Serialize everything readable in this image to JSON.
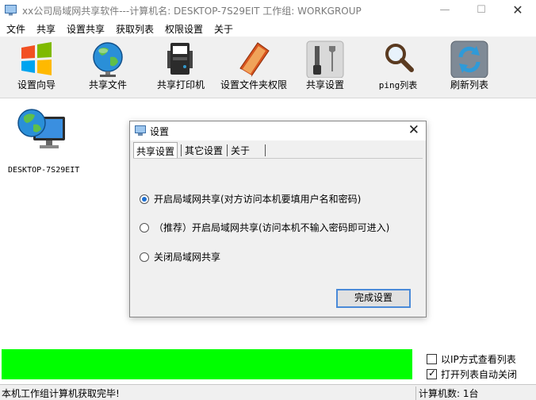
{
  "window": {
    "title": "xx公司局域网共享软件---计算机名: DESKTOP-7S29EIT   工作组: WORKGROUP",
    "minimize_glyph": "—",
    "maximize_glyph": "☐",
    "close_glyph": "✕"
  },
  "menu": [
    "文件",
    "共享",
    "设置共享",
    "获取列表",
    "权限设置",
    "关于"
  ],
  "toolbar": [
    {
      "label": "设置向导",
      "icon": "windows-logo-icon"
    },
    {
      "label": "共享文件",
      "icon": "globe-icon"
    },
    {
      "label": "共享打印机",
      "icon": "printer-icon"
    },
    {
      "label": "设置文件夹权限",
      "icon": "book-icon"
    },
    {
      "label": "共享设置",
      "icon": "tools-icon"
    },
    {
      "label": "ping列表",
      "icon": "magnifier-icon"
    },
    {
      "label": "刷新列表",
      "icon": "refresh-icon"
    }
  ],
  "computers": [
    {
      "name": "DESKTOP-7S29EIT",
      "icon": "network-computer-icon"
    }
  ],
  "dialog": {
    "title": "设置",
    "close_glyph": "✕",
    "tabs": [
      "共享设置",
      "其它设置",
      "关于"
    ],
    "active_tab": 0,
    "options": [
      {
        "label": "开启局域网共享(对方访问本机要填用户名和密码)",
        "selected": true
      },
      {
        "label": "（推荐）开启局域网共享(访问本机不输入密码即可进入)",
        "selected": false
      },
      {
        "label": "关闭局域网共享",
        "selected": false
      }
    ],
    "done_button": "完成设置"
  },
  "progress": {
    "value": 1.0,
    "color": "#00ff00"
  },
  "checkboxes": [
    {
      "label": "以IP方式查看列表",
      "checked": false
    },
    {
      "label": "打开列表自动关闭",
      "checked": true
    }
  ],
  "status": {
    "message": "本机工作组计算机获取完毕!",
    "count": "计算机数: 1台"
  }
}
